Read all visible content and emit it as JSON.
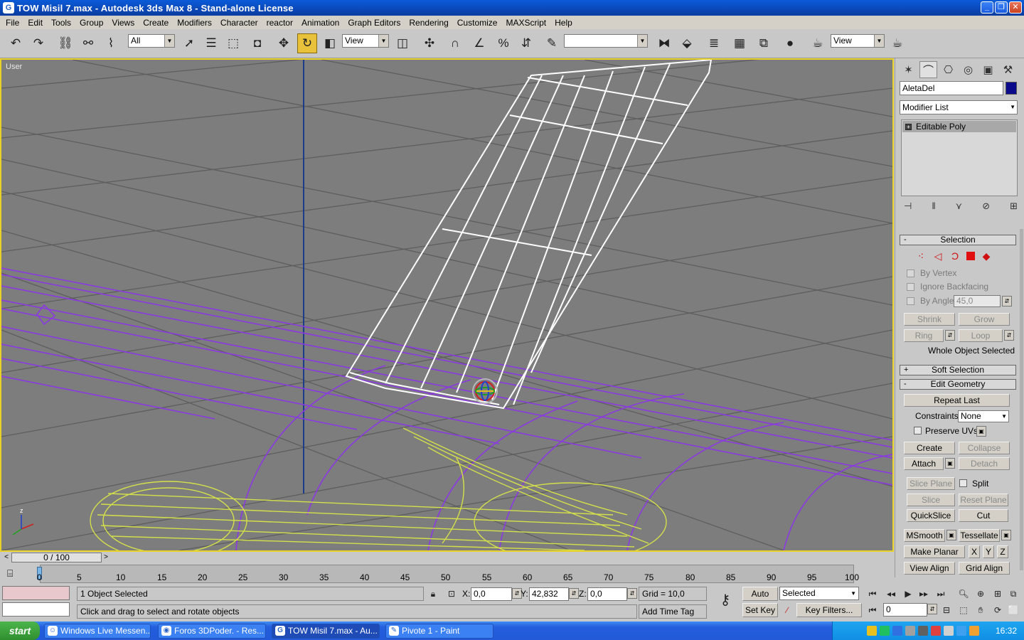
{
  "window": {
    "title": "TOW Misil 7.max - Autodesk 3ds Max 8  - Stand-alone License",
    "icon": "3dsmax-icon"
  },
  "menu": [
    "File",
    "Edit",
    "Tools",
    "Group",
    "Views",
    "Create",
    "Modifiers",
    "Character",
    "reactor",
    "Animation",
    "Graph Editors",
    "Rendering",
    "Customize",
    "MAXScript",
    "Help"
  ],
  "toolbar": {
    "selection_filter": "All",
    "ref_coord": "View",
    "named_selection": "",
    "view_dropdown2": "View"
  },
  "viewport": {
    "label": "User"
  },
  "command_panel": {
    "object_name": "AletaDel",
    "object_color": "#0a0a8a",
    "modifier_list": "Modifier List",
    "stack_items": [
      "Editable Poly"
    ],
    "selection": {
      "title": "Selection",
      "by_vertex": "By Vertex",
      "ignore_backfacing": "Ignore Backfacing",
      "by_angle": "By Angle:",
      "by_angle_value": "45,0",
      "shrink": "Shrink",
      "grow": "Grow",
      "ring": "Ring",
      "loop": "Loop",
      "status": "Whole Object Selected"
    },
    "soft_selection": {
      "title": "Soft Selection"
    },
    "edit_geometry": {
      "title": "Edit Geometry",
      "repeat_last": "Repeat Last",
      "constraints_label": "Constraints:",
      "constraints_value": "None",
      "preserve_uvs": "Preserve UVs",
      "create": "Create",
      "collapse": "Collapse",
      "attach": "Attach",
      "detach": "Detach",
      "slice_plane": "Slice Plane",
      "split": "Split",
      "slice": "Slice",
      "reset_plane": "Reset Plane",
      "quickslice": "QuickSlice",
      "cut": "Cut",
      "msmooth": "MSmooth",
      "tessellate": "Tessellate",
      "make_planar": "Make Planar",
      "x": "X",
      "y": "Y",
      "z": "Z",
      "view_align": "View Align",
      "grid_align": "Grid Align"
    }
  },
  "timeline": {
    "slider": "0 / 100",
    "ticks": [
      "0",
      "5",
      "10",
      "15",
      "20",
      "25",
      "30",
      "35",
      "40",
      "45",
      "50",
      "55",
      "60",
      "65",
      "70",
      "75",
      "80",
      "85",
      "90",
      "95",
      "100"
    ]
  },
  "status": {
    "selected": "1 Object Selected",
    "prompt": "Click and drag to select and rotate objects",
    "x_label": "X:",
    "x_value": "0,0",
    "y_label": "Y:",
    "y_value": "42,832",
    "z_label": "Z:",
    "z_value": "0,0",
    "grid": "Grid = 10,0",
    "add_time_tag": "Add Time Tag",
    "auto_key": "Auto Key",
    "set_key": "Set Key",
    "key_mode": "Selected",
    "key_filters": "Key Filters...",
    "frame": "0"
  },
  "taskbar": {
    "start": "start",
    "tasks": [
      "Windows Live Messen...",
      "Foros 3DPoder. - Res...",
      "TOW Misil 7.max - Au...",
      "Pivote 1 - Paint"
    ],
    "clock": "16:32"
  }
}
